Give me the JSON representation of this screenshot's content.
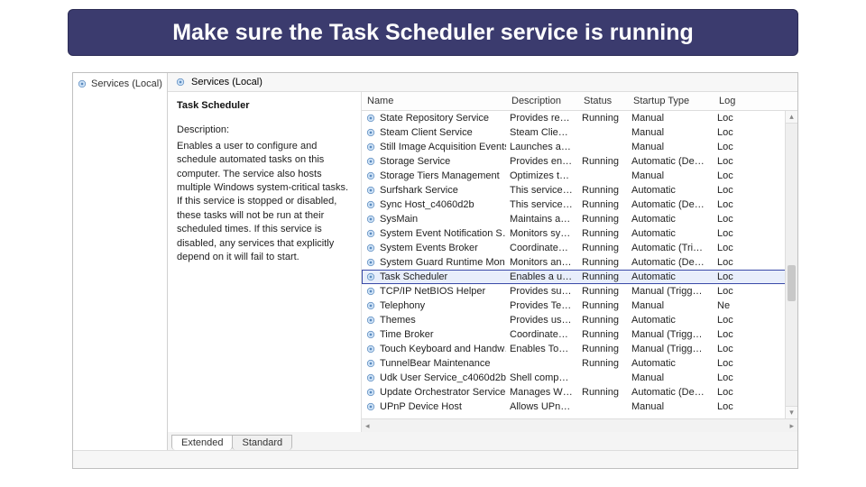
{
  "banner": "Make sure the Task Scheduler service is running",
  "tree": {
    "item": "Services (Local)"
  },
  "detail": {
    "header": "Services (Local)",
    "selectedService": "Task Scheduler",
    "descriptionLabel": "Description:",
    "description": "Enables a user to configure and schedule automated tasks on this computer. The service also hosts multiple Windows system-critical tasks. If this service is stopped or disabled, these tasks will not be run at their scheduled times. If this service is disabled, any services that explicitly depend on it will fail to start."
  },
  "columns": {
    "name": "Name",
    "description": "Description",
    "status": "Status",
    "startup": "Startup Type",
    "logon": "Log"
  },
  "tabs": {
    "extended": "Extended",
    "standard": "Standard"
  },
  "services": [
    {
      "name": "State Repository Service",
      "desc": "Provides req…",
      "status": "Running",
      "startup": "Manual",
      "log": "Loc"
    },
    {
      "name": "Steam Client Service",
      "desc": "Steam Client…",
      "status": "",
      "startup": "Manual",
      "log": "Loc"
    },
    {
      "name": "Still Image Acquisition Events",
      "desc": "Launches ap…",
      "status": "",
      "startup": "Manual",
      "log": "Loc"
    },
    {
      "name": "Storage Service",
      "desc": "Provides ena…",
      "status": "Running",
      "startup": "Automatic (De…",
      "log": "Loc"
    },
    {
      "name": "Storage Tiers Management",
      "desc": "Optimizes th…",
      "status": "",
      "startup": "Manual",
      "log": "Loc"
    },
    {
      "name": "Surfshark Service",
      "desc": "This service i…",
      "status": "Running",
      "startup": "Automatic",
      "log": "Loc"
    },
    {
      "name": "Sync Host_c4060d2b",
      "desc": "This service …",
      "status": "Running",
      "startup": "Automatic (De…",
      "log": "Loc"
    },
    {
      "name": "SysMain",
      "desc": "Maintains a…",
      "status": "Running",
      "startup": "Automatic",
      "log": "Loc"
    },
    {
      "name": "System Event Notification S…",
      "desc": "Monitors sy…",
      "status": "Running",
      "startup": "Automatic",
      "log": "Loc"
    },
    {
      "name": "System Events Broker",
      "desc": "Coordinates …",
      "status": "Running",
      "startup": "Automatic (Tri…",
      "log": "Loc"
    },
    {
      "name": "System Guard Runtime Mon…",
      "desc": "Monitors an…",
      "status": "Running",
      "startup": "Automatic (De…",
      "log": "Loc"
    },
    {
      "name": "Task Scheduler",
      "desc": "Enables a us…",
      "status": "Running",
      "startup": "Automatic",
      "log": "Loc",
      "selected": true
    },
    {
      "name": "TCP/IP NetBIOS Helper",
      "desc": "Provides sup…",
      "status": "Running",
      "startup": "Manual (Trigg…",
      "log": "Loc"
    },
    {
      "name": "Telephony",
      "desc": "Provides Tel…",
      "status": "Running",
      "startup": "Manual",
      "log": "Ne"
    },
    {
      "name": "Themes",
      "desc": "Provides use…",
      "status": "Running",
      "startup": "Automatic",
      "log": "Loc"
    },
    {
      "name": "Time Broker",
      "desc": "Coordinates …",
      "status": "Running",
      "startup": "Manual (Trigg…",
      "log": "Loc"
    },
    {
      "name": "Touch Keyboard and Handw…",
      "desc": "Enables Tou…",
      "status": "Running",
      "startup": "Manual (Trigg…",
      "log": "Loc"
    },
    {
      "name": "TunnelBear Maintenance",
      "desc": "",
      "status": "Running",
      "startup": "Automatic",
      "log": "Loc"
    },
    {
      "name": "Udk User Service_c4060d2b",
      "desc": "Shell compo…",
      "status": "",
      "startup": "Manual",
      "log": "Loc"
    },
    {
      "name": "Update Orchestrator Service",
      "desc": "Manages Wi…",
      "status": "Running",
      "startup": "Automatic (De…",
      "log": "Loc"
    },
    {
      "name": "UPnP Device Host",
      "desc": "Allows UPnP …",
      "status": "",
      "startup": "Manual",
      "log": "Loc"
    }
  ]
}
